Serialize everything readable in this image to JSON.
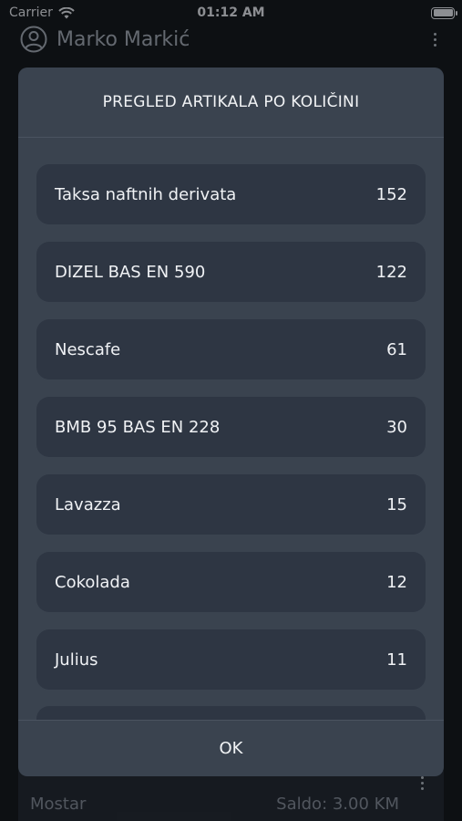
{
  "status_bar": {
    "carrier": "Carrier",
    "time": "01:12 AM"
  },
  "header": {
    "user_name": "Marko Markić"
  },
  "background_card": {
    "city": "Mostar",
    "saldo": "Saldo: 3.00 KM"
  },
  "dialog": {
    "title": "PREGLED ARTIKALA PO KOLIČINI",
    "items": [
      {
        "name": "Taksa naftnih derivata",
        "quantity": "152"
      },
      {
        "name": "DIZEL BAS EN 590",
        "quantity": "122"
      },
      {
        "name": "Nescafe",
        "quantity": "61"
      },
      {
        "name": "BMB 95 BAS EN 228",
        "quantity": "30"
      },
      {
        "name": "Lavazza",
        "quantity": "15"
      },
      {
        "name": "Cokolada",
        "quantity": "12"
      },
      {
        "name": "Julius",
        "quantity": "11"
      }
    ],
    "ok_label": "OK"
  }
}
